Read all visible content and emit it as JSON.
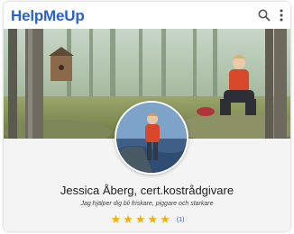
{
  "header": {
    "logo": "HelpMeUp",
    "search_icon": "search-icon",
    "menu_icon": "more-vertical-icon"
  },
  "profile": {
    "name": "Jessica Åberg, cert.kostrådgivare",
    "tagline": "Jag hjälper dig bli friskare, piggare och starkare",
    "rating": 5,
    "rating_max": 5,
    "review_count": "(1)"
  },
  "colors": {
    "brand": "#2a62c9",
    "star": "#f0b400"
  }
}
